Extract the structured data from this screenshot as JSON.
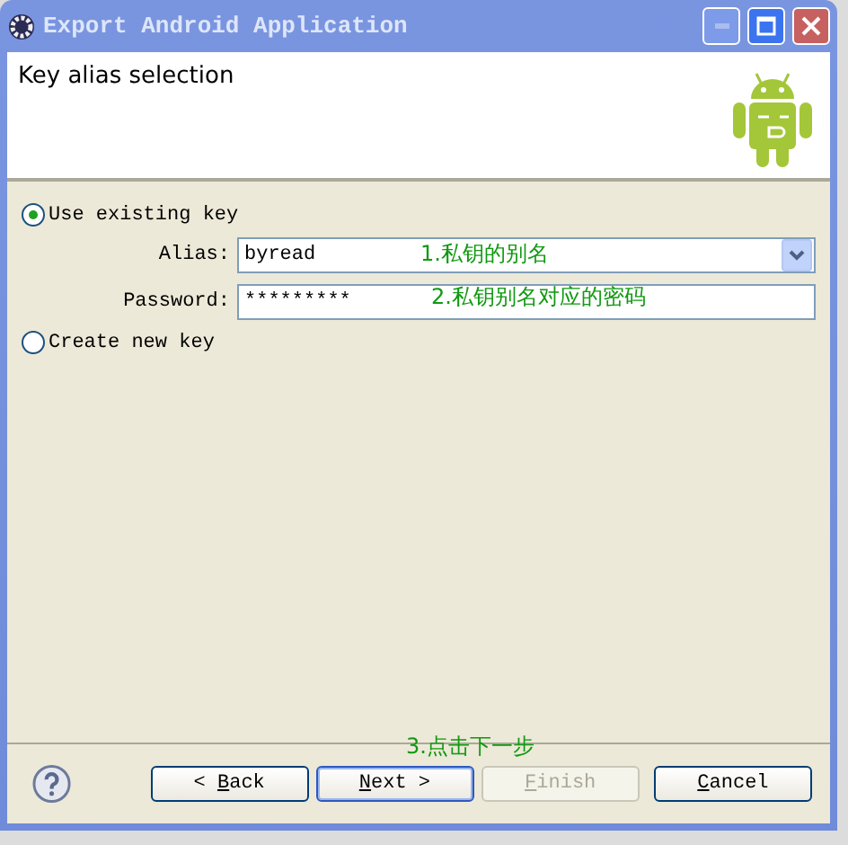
{
  "window": {
    "title": "Export Android Application"
  },
  "header": {
    "title": "Key alias selection"
  },
  "options": [
    {
      "label": "Use existing key",
      "selected": true
    },
    {
      "label": "Create new key",
      "selected": false
    }
  ],
  "fields": [
    {
      "kind": "dropdown",
      "label": "Alias:",
      "value": "byread"
    },
    {
      "kind": "password",
      "label": "Password:",
      "value": "*********"
    }
  ],
  "annotations": [
    {
      "text": "1.私钥的别名",
      "color": "#119911"
    },
    {
      "text": "2.私钥别名对应的密码",
      "color": "#119911"
    },
    {
      "text": "3.点击下一步",
      "color": "#119911"
    }
  ],
  "buttons": [
    {
      "prefix": "<",
      "label": "Back",
      "disabled": false,
      "default": false
    },
    {
      "label": "Next",
      "suffix": ">",
      "disabled": false,
      "default": true
    },
    {
      "label": "Finish",
      "disabled": true,
      "default": false
    },
    {
      "label": "Cancel",
      "disabled": false,
      "default": false
    }
  ]
}
